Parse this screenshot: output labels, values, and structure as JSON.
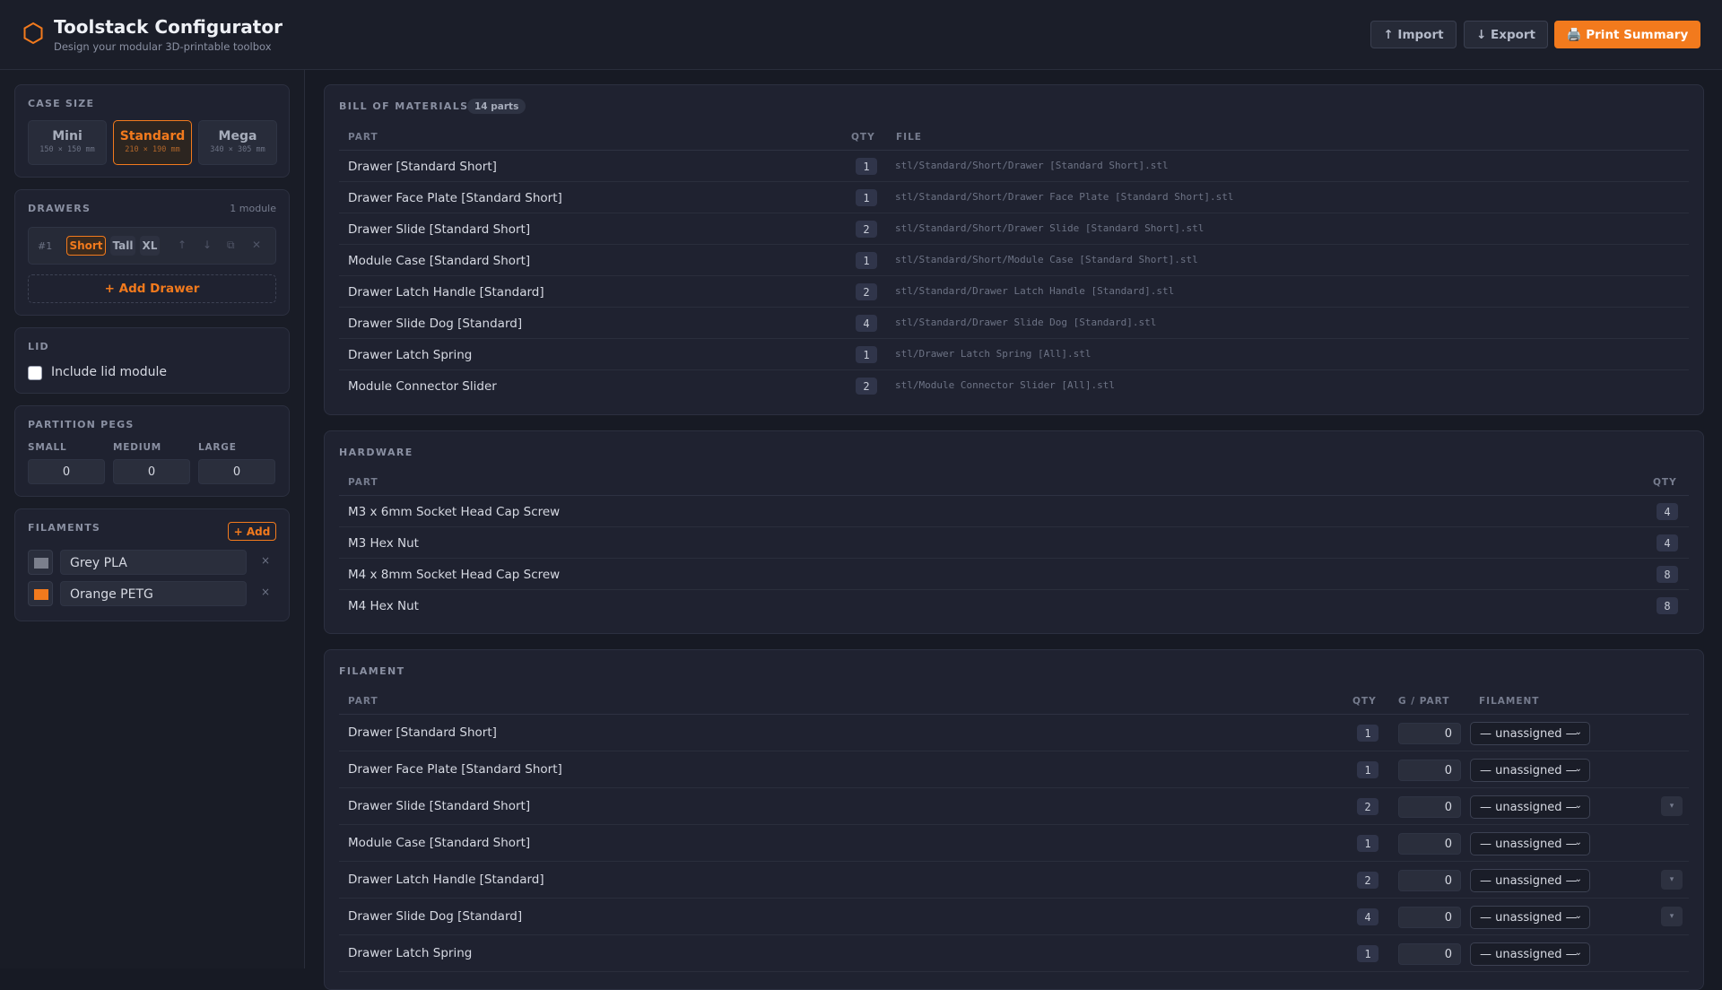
{
  "header": {
    "title": "Toolstack Configurator",
    "subtitle": "Design your modular 3D-printable toolbox",
    "import_label": "↑ Import",
    "export_label": "↓ Export",
    "print_label": "🖨️ Print Summary",
    "accent": "#f27a1d"
  },
  "sidebar": {
    "case_size": {
      "title": "CASE SIZE",
      "options": [
        {
          "name": "Mini",
          "dims": "150 × 150 mm"
        },
        {
          "name": "Standard",
          "dims": "210 × 190 mm"
        },
        {
          "name": "Mega",
          "dims": "340 × 305 mm"
        }
      ],
      "selected": "Standard"
    },
    "drawers": {
      "title": "DRAWERS",
      "count": "1 module",
      "row_number": "#1",
      "heights": [
        "Short",
        "Tall",
        "XL"
      ],
      "selected_height": "Short",
      "icons": [
        "arrow-up-icon",
        "arrow-down-icon",
        "duplicate-icon",
        "close-icon"
      ],
      "add_label": "+ Add Drawer"
    },
    "lid": {
      "title": "LID",
      "checkbox_label": "Include lid module",
      "checked": false
    },
    "pegs": {
      "title": "PARTITION PEGS",
      "small_label": "SMALL",
      "small_value": "0",
      "medium_label": "MEDIUM",
      "medium_value": "0",
      "large_label": "LARGE",
      "large_value": "0"
    },
    "filaments": {
      "title": "FILAMENTS",
      "add_label": "+ Add",
      "items": [
        {
          "name": "Grey PLA",
          "color": "#7b7f8c"
        },
        {
          "name": "Orange PETG",
          "color": "#f27a1d"
        }
      ],
      "remove_glyph": "×"
    }
  },
  "bom": {
    "title": "BILL OF MATERIALS",
    "badge": "14 parts",
    "columns": {
      "part": "PART",
      "qty": "QTY",
      "file": "FILE"
    },
    "rows": [
      {
        "part": "Drawer [Standard Short]",
        "qty": "1",
        "file": "stl/Standard/Short/Drawer [Standard Short].stl"
      },
      {
        "part": "Drawer Face Plate [Standard Short]",
        "qty": "1",
        "file": "stl/Standard/Short/Drawer Face Plate [Standard Short].stl"
      },
      {
        "part": "Drawer Slide [Standard Short]",
        "qty": "2",
        "file": "stl/Standard/Short/Drawer Slide [Standard Short].stl"
      },
      {
        "part": "Module Case [Standard Short]",
        "qty": "1",
        "file": "stl/Standard/Short/Module Case [Standard Short].stl"
      },
      {
        "part": "Drawer Latch Handle [Standard]",
        "qty": "2",
        "file": "stl/Standard/Drawer Latch Handle [Standard].stl"
      },
      {
        "part": "Drawer Slide Dog [Standard]",
        "qty": "4",
        "file": "stl/Standard/Drawer Slide Dog [Standard].stl"
      },
      {
        "part": "Drawer Latch Spring",
        "qty": "1",
        "file": "stl/Drawer Latch Spring [All].stl"
      },
      {
        "part": "Module Connector Slider",
        "qty": "2",
        "file": "stl/Module Connector Slider [All].stl"
      }
    ]
  },
  "hardware": {
    "title": "HARDWARE",
    "columns": {
      "part": "PART",
      "qty": "QTY"
    },
    "rows": [
      {
        "part": "M3 x 6mm Socket Head Cap Screw",
        "qty": "4"
      },
      {
        "part": "M3 Hex Nut",
        "qty": "4"
      },
      {
        "part": "M4 x 8mm Socket Head Cap Screw",
        "qty": "8"
      },
      {
        "part": "M4 Hex Nut",
        "qty": "8"
      }
    ]
  },
  "filament": {
    "title": "FILAMENT",
    "columns": {
      "part": "PART",
      "qty": "QTY",
      "g_per_part": "G / PART",
      "filament": "FILAMENT"
    },
    "rows": [
      {
        "part": "Drawer [Standard Short]",
        "qty": "1",
        "grams": "0",
        "filament": "— unassigned —",
        "expand": false
      },
      {
        "part": "Drawer Face Plate [Standard Short]",
        "qty": "1",
        "grams": "0",
        "filament": "— unassigned —",
        "expand": false
      },
      {
        "part": "Drawer Slide [Standard Short]",
        "qty": "2",
        "grams": "0",
        "filament": "— unassigned —",
        "expand": true
      },
      {
        "part": "Module Case [Standard Short]",
        "qty": "1",
        "grams": "0",
        "filament": "— unassigned —",
        "expand": false
      },
      {
        "part": "Drawer Latch Handle [Standard]",
        "qty": "2",
        "grams": "0",
        "filament": "— unassigned —",
        "expand": true
      },
      {
        "part": "Drawer Slide Dog [Standard]",
        "qty": "4",
        "grams": "0",
        "filament": "— unassigned —",
        "expand": true
      },
      {
        "part": "Drawer Latch Spring",
        "qty": "1",
        "grams": "0",
        "filament": "— unassigned —",
        "expand": false
      }
    ],
    "expand_glyph": "▾"
  }
}
